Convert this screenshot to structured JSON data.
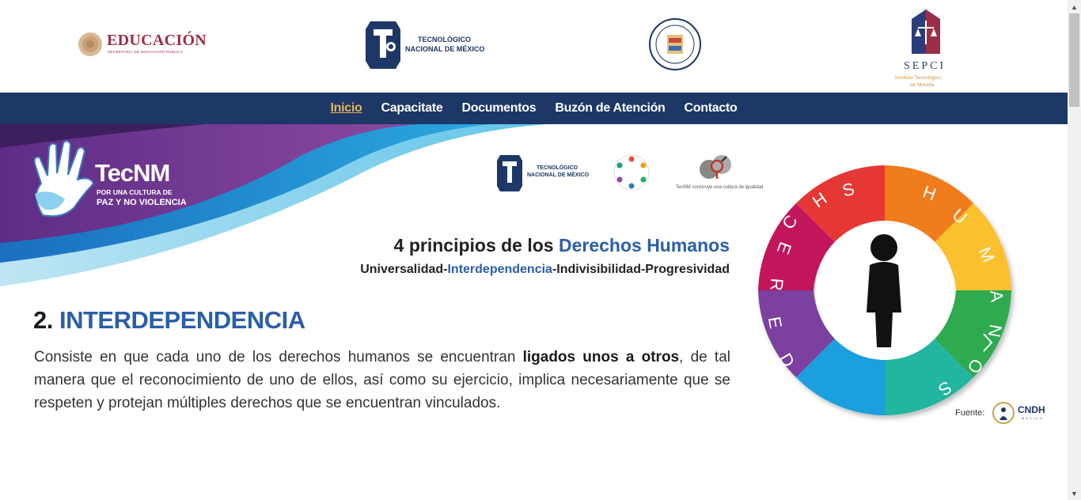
{
  "header": {
    "logos": {
      "educacion": {
        "text": "EDUCACIÓN",
        "sub": "SECRETARÍA DE EDUCACIÓN PÚBLICA"
      },
      "tecnm": {
        "line1": "TECNOLÓGICO",
        "line2": "NACIONAL DE MÉXICO"
      },
      "seal": {
        "ring_text": "Instituto Tecnológico José María Morelos y Pavón"
      },
      "sepci": {
        "text": "SEPCI",
        "sub1": "Instituto Tecnológico",
        "sub2": "de Morelia"
      }
    }
  },
  "nav": {
    "items": [
      {
        "label": "Inicio",
        "active": true
      },
      {
        "label": "Capacitate",
        "active": false
      },
      {
        "label": "Documentos",
        "active": false
      },
      {
        "label": "Buzón de Atención",
        "active": false
      },
      {
        "label": "Contacto",
        "active": false
      }
    ]
  },
  "banner": {
    "tecnm_brand": "TecNM",
    "tecnm_slogan1": "POR UNA CULTURA DE",
    "tecnm_slogan2": "PAZ Y NO VIOLENCIA",
    "small_tecnm1": "TECNOLÓGICO",
    "small_tecnm2": "NACIONAL DE MÉXICO",
    "equality_caption": "TecNM construye una cultura de igualdad",
    "heading_pre": "4 principios de los ",
    "heading_blue": "Derechos Humanos",
    "principles_a": "Universalidad-",
    "principles_b": "Interdependencia",
    "principles_c": "-Indivisibilidad-Progresividad",
    "section_num": "2. ",
    "section_title": "INTERDEPENDENCIA",
    "body_a": "Consiste en que cada uno de los derechos humanos se encuentran ",
    "body_bold": "ligados unos a otros",
    "body_b": ", de tal manera que el reconocimiento de uno de ellos, así como su ejercicio, implica necesariamente que se respeten y protejan múltiples derechos que se encuentran vinculados.",
    "puzzle_letters": [
      "D",
      "E",
      "R",
      "E",
      "C",
      "H",
      "O",
      "S",
      "H",
      "U",
      "M",
      "A",
      "N",
      "O",
      "S"
    ],
    "fuente": "Fuente:",
    "cndh": "CNDH",
    "cndh_sub": "MÉXICO"
  },
  "colors": {
    "nav_bg": "#1d3767",
    "nav_active": "#e6b652",
    "accent_blue": "#2a5ea8"
  }
}
